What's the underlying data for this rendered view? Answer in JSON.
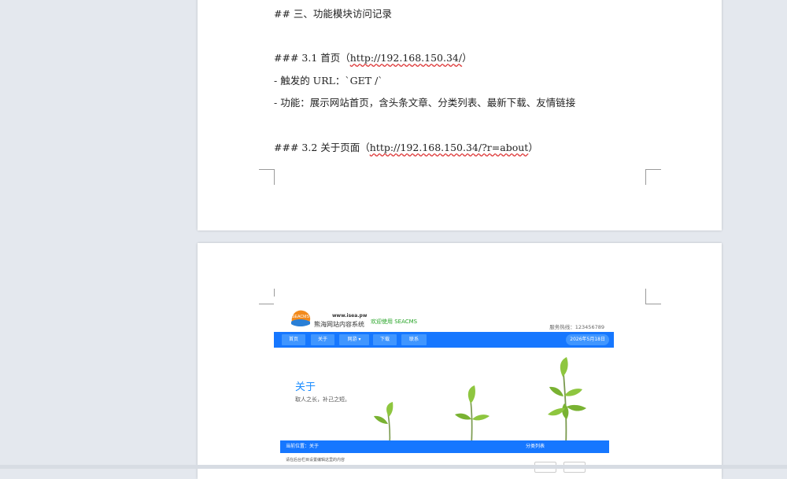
{
  "doc": {
    "heading_modules": "## 三、功能模块访问记录",
    "sec31": {
      "prefix": "### 3.1 首页（",
      "url": "http://192.168.150.34/",
      "suffix": "）"
    },
    "trigger_url": "- 触发的 URL：`GET /`",
    "function_line": "- 功能：展示网站首页，含头条文章、分类列表、最新下载、友情链接",
    "sec32": {
      "prefix": "### 3.2 关于页面（",
      "url": "http://192.168.150.34/?r=about",
      "suffix": "）"
    }
  },
  "site": {
    "domain": "www.isea.pw",
    "logo_text": "SEACMS",
    "name": "熊海网站内容系统",
    "welcome": "欢迎使用 SEACMS",
    "hotline": "服务热线：123456789",
    "nav": [
      "首页",
      "关于",
      "网游 ▾",
      "下载",
      "联系"
    ],
    "date": "2026年5月18日",
    "banner_title": "关于",
    "banner_subtitle": "取人之长，补己之短。",
    "breadcrumb": "当前位置：关于",
    "sidebar_title": "分类列表",
    "body_text": "请在后台栏目设置编辑这里的内容"
  },
  "colors": {
    "accent": "#1677ff",
    "title": "#1a8cff",
    "welcome": "#27a427",
    "logo": "#f28a1c"
  }
}
